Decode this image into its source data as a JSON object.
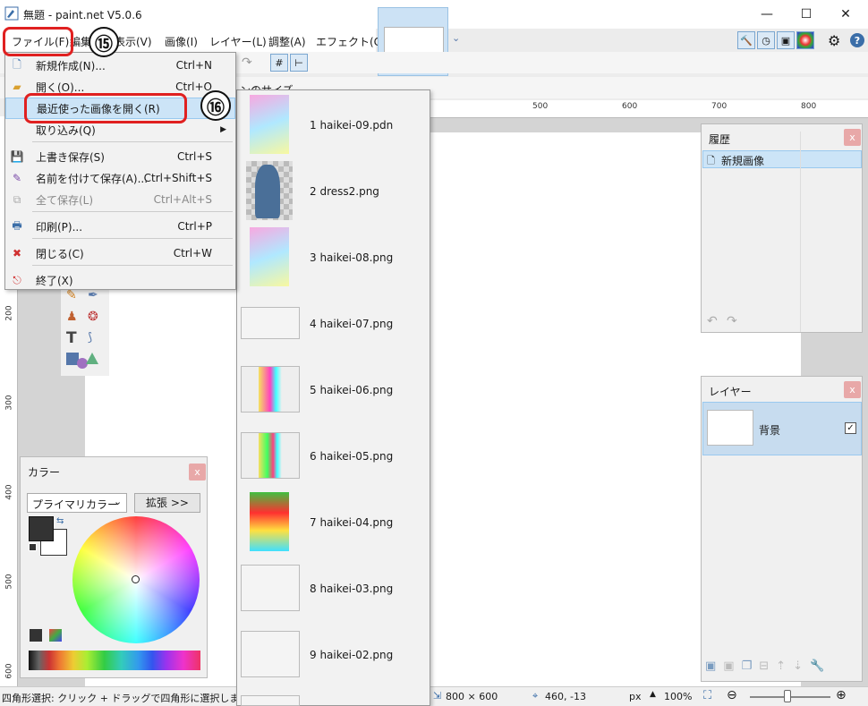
{
  "window": {
    "title": "無題 - paint.net V5.0.6",
    "minimize": "—",
    "maximize": "☐",
    "close": "✕"
  },
  "menubar": {
    "items": [
      "ファイル(F)",
      "編集(E)",
      "表示(V)",
      "画像(I)",
      "レイヤー(L)",
      "調整(A)",
      "エフェクト(C)"
    ]
  },
  "file_menu": {
    "items": [
      {
        "label": "新規作成(N)...",
        "shortcut": "Ctrl+N"
      },
      {
        "label": "開く(O)...",
        "shortcut": "Ctrl+O"
      },
      {
        "label": "最近使った画像を開く(R)",
        "shortcut": ""
      },
      {
        "label": "取り込み(Q)",
        "shortcut": ""
      },
      {
        "label": "上書き保存(S)",
        "shortcut": "Ctrl+S"
      },
      {
        "label": "名前を付けて保存(A)...",
        "shortcut": "Ctrl+Shift+S"
      },
      {
        "label": "全て保存(L)",
        "shortcut": "Ctrl+Alt+S"
      },
      {
        "label": "印刷(P)...",
        "shortcut": "Ctrl+P"
      },
      {
        "label": "閉じる(C)",
        "shortcut": "Ctrl+W"
      },
      {
        "label": "終了(X)",
        "shortcut": ""
      }
    ]
  },
  "recent_files": [
    "1 haikei-09.pdn",
    "2 dress2.png",
    "3 haikei-08.png",
    "4 haikei-07.png",
    "5 haikei-06.png",
    "6 haikei-05.png",
    "7 haikei-04.png",
    "8 haikei-03.png",
    "9 haikei-02.png"
  ],
  "annotations": {
    "a15": "⑮",
    "a16": "⑯"
  },
  "toolbar_partial": "ンのサイズ",
  "ruler": {
    "h": [
      "500",
      "600",
      "700",
      "800"
    ],
    "v": [
      "200",
      "300",
      "400",
      "500",
      "600"
    ]
  },
  "history_panel": {
    "title": "履歴",
    "item": "新規画像",
    "close": "x"
  },
  "layers_panel": {
    "title": "レイヤー",
    "layer": "背景",
    "close": "x"
  },
  "color_panel": {
    "title": "カラー",
    "mode": "プライマリカラー",
    "expand": "拡張 >>",
    "close": "x"
  },
  "status": {
    "hint": "四角形選択: クリック + ドラッグで四角形に選択します。Shift+",
    "size": "800 × 600",
    "cursor": "460, -13",
    "unit": "px",
    "zoom": "100%"
  }
}
